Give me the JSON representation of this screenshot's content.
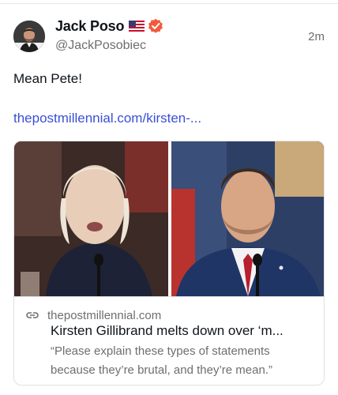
{
  "post": {
    "author": {
      "display_name": "Jack Poso",
      "handle": "@JackPosobiec",
      "flag_icon": "us-flag-icon",
      "verified_icon": "verified-badge-icon",
      "verified_color": "#f25a3c"
    },
    "timestamp": "2m",
    "text": "Mean Pete!",
    "link_text": "thepostmillennial.com/kirsten-..."
  },
  "link_card": {
    "icon": "link-icon",
    "domain": "thepostmillennial.com",
    "title": "Kirsten Gillibrand melts down over ‘m...",
    "description": "“Please explain these types of statements because they’re brutal, and they’re mean.”"
  },
  "colors": {
    "link": "#3a4fd7",
    "secondary_text": "#6e6e73"
  }
}
